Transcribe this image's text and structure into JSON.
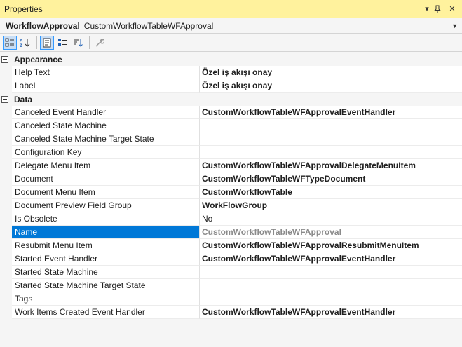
{
  "window": {
    "title": "Properties",
    "buttons": {
      "dropdown": "▾",
      "pin": "⊣",
      "close": "✕"
    }
  },
  "object": {
    "name": "WorkflowApproval",
    "type": "CustomWorkflowTableWFApproval"
  },
  "toolbar": {
    "icons": [
      "categorized-icon",
      "alphabetical-icon",
      "properties-icon",
      "events-icon",
      "sort-icon",
      "wrench-icon"
    ]
  },
  "categories": [
    {
      "label": "Appearance",
      "rows": [
        {
          "name": "Help Text",
          "value": "Özel iş akışı onay",
          "style": "bold"
        },
        {
          "name": "Label",
          "value": "Özel iş akışı onay",
          "style": "bold"
        }
      ]
    },
    {
      "label": "Data",
      "rows": [
        {
          "name": "Canceled Event Handler",
          "value": "CustomWorkflowTableWFApprovalEventHandler",
          "style": "bold"
        },
        {
          "name": "Canceled State Machine",
          "value": "",
          "style": "bold"
        },
        {
          "name": "Canceled State Machine Target State",
          "value": "",
          "style": "bold"
        },
        {
          "name": "Configuration Key",
          "value": "",
          "style": "bold"
        },
        {
          "name": "Delegate Menu Item",
          "value": "CustomWorkflowTableWFApprovalDelegateMenuItem",
          "style": "bold"
        },
        {
          "name": "Document",
          "value": "CustomWorkflowTableWFTypeDocument",
          "style": "bold"
        },
        {
          "name": "Document Menu Item",
          "value": "CustomWorkflowTable",
          "style": "bold"
        },
        {
          "name": "Document Preview Field Group",
          "value": "WorkFlowGroup",
          "style": "bold"
        },
        {
          "name": "Is Obsolete",
          "value": "No",
          "style": "normal"
        },
        {
          "name": "Name",
          "value": "CustomWorkflowTableWFApproval",
          "style": "disabled",
          "selected": true
        },
        {
          "name": "Resubmit Menu Item",
          "value": "CustomWorkflowTableWFApprovalResubmitMenuItem",
          "style": "bold"
        },
        {
          "name": "Started Event Handler",
          "value": "CustomWorkflowTableWFApprovalEventHandler",
          "style": "bold"
        },
        {
          "name": "Started State Machine",
          "value": "",
          "style": "bold"
        },
        {
          "name": "Started State Machine Target State",
          "value": "",
          "style": "bold"
        },
        {
          "name": "Tags",
          "value": "",
          "style": "bold"
        },
        {
          "name": "Work Items Created Event Handler",
          "value": "CustomWorkflowTableWFApprovalEventHandler",
          "style": "bold"
        }
      ]
    }
  ]
}
